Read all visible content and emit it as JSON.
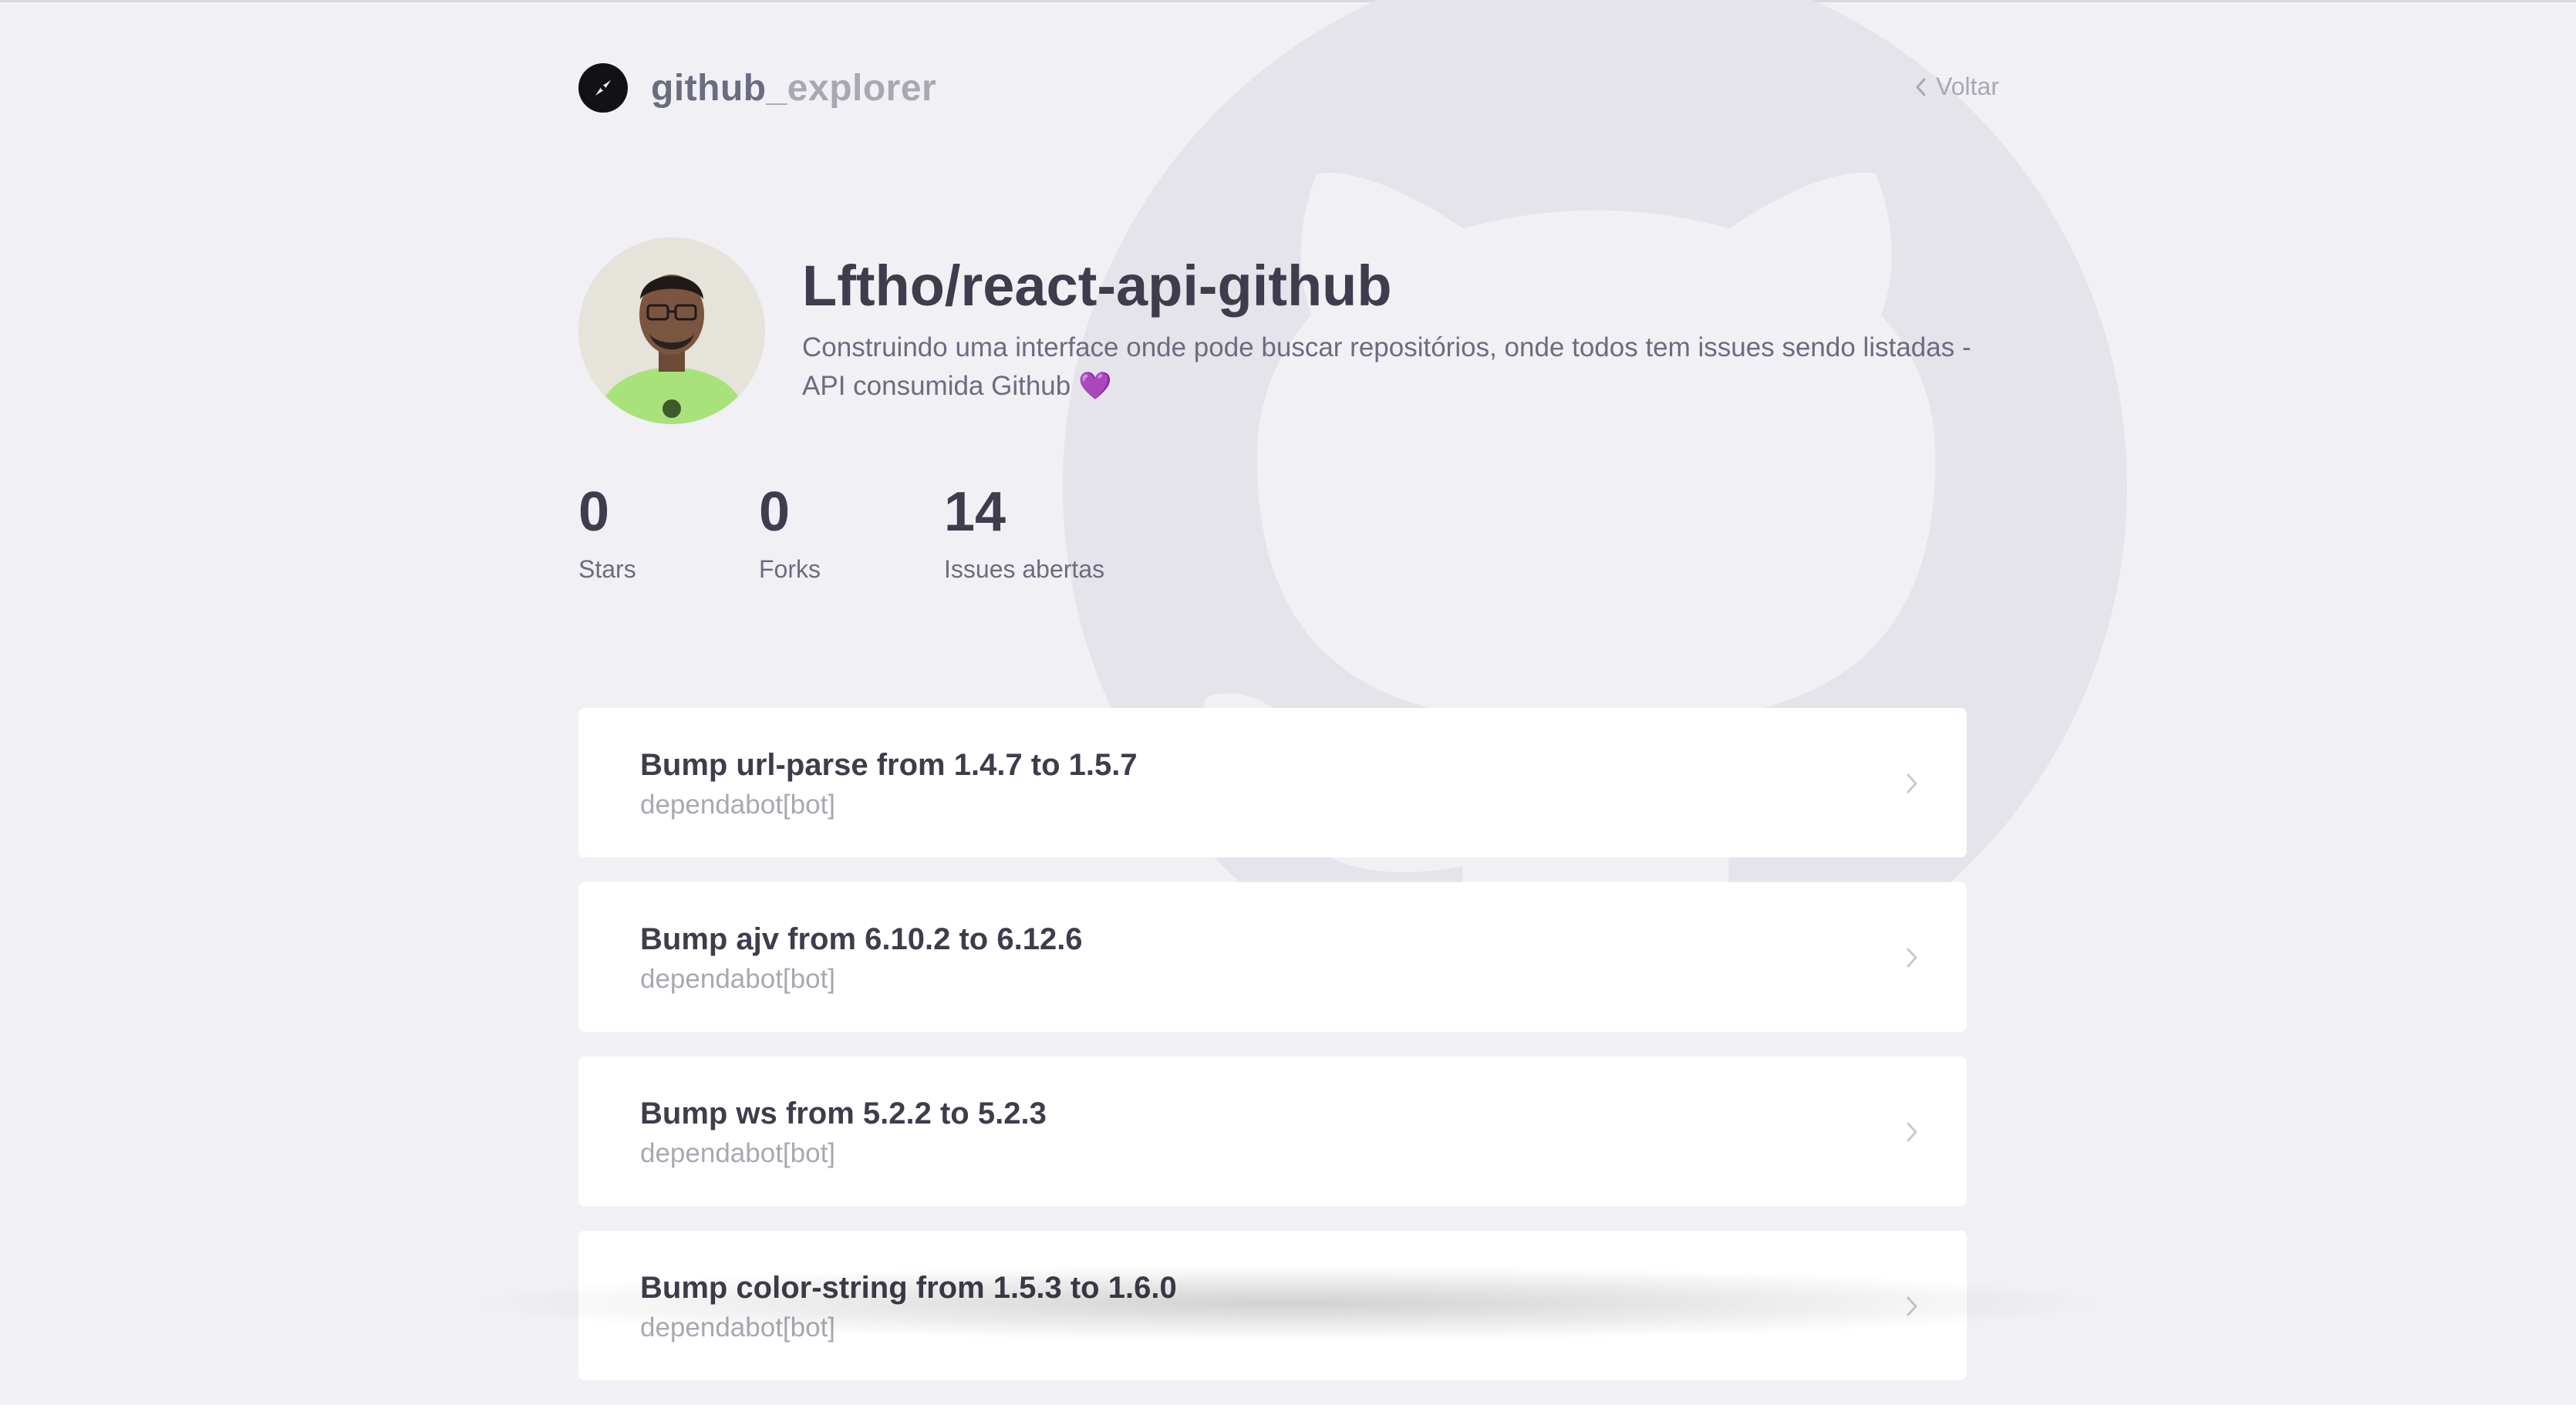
{
  "header": {
    "logo_text_main": "github",
    "logo_text_accent": "_explorer",
    "back_label": "Voltar"
  },
  "repository": {
    "full_name": "Lftho/react-api-github",
    "description": "Construindo uma interface onde pode buscar repositórios, onde todos tem issues sendo listadas - API consumida Github 💜"
  },
  "stats": [
    {
      "value": "0",
      "label": "Stars"
    },
    {
      "value": "0",
      "label": "Forks"
    },
    {
      "value": "14",
      "label": "Issues abertas"
    }
  ],
  "issues": [
    {
      "title": "Bump url-parse from 1.4.7 to 1.5.7",
      "author": "dependabot[bot]"
    },
    {
      "title": "Bump ajv from 6.10.2 to 6.12.6",
      "author": "dependabot[bot]"
    },
    {
      "title": "Bump ws from 5.2.2 to 5.2.3",
      "author": "dependabot[bot]"
    },
    {
      "title": "Bump color-string from 1.5.3 to 1.6.0",
      "author": "dependabot[bot]"
    }
  ],
  "colors": {
    "background": "#f0f0f5",
    "text_primary": "#3d3d4d",
    "text_secondary": "#6c6c80",
    "text_muted": "#a8a8b3",
    "card": "#ffffff"
  }
}
